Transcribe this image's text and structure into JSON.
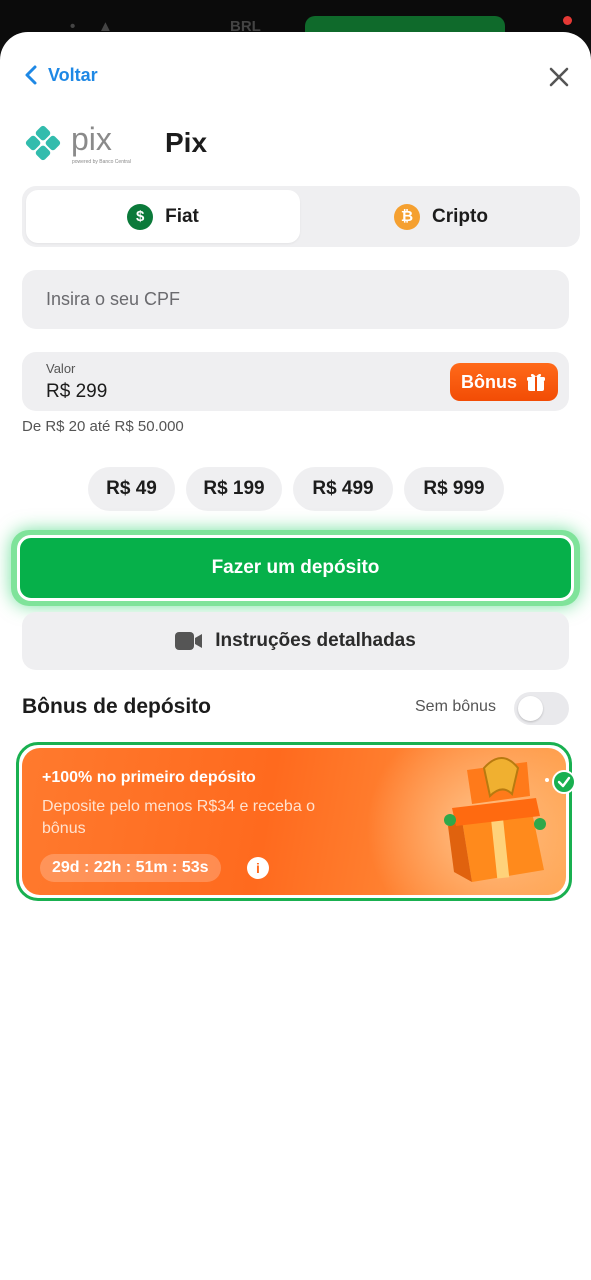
{
  "topbar": {
    "currency": "BRL"
  },
  "header": {
    "back_label": "Voltar"
  },
  "method": {
    "title": "Pix",
    "logo_text": "pix",
    "logo_subtext": "powered by Banco Central"
  },
  "tabs": [
    {
      "label": "Fiat",
      "icon": "dollar-icon",
      "active": true
    },
    {
      "label": "Cripto",
      "icon": "bitcoin-icon",
      "active": false
    }
  ],
  "form": {
    "cpf_placeholder": "Insira o seu CPF",
    "amount_label": "Valor",
    "amount_value": "R$ 299",
    "bonus_button": "Bônus",
    "range_text": "De R$ 20 até R$ 50.000"
  },
  "quick_amounts": [
    "R$ 49",
    "R$ 199",
    "R$ 499",
    "R$ 999"
  ],
  "deposit_button": "Fazer um depósito",
  "instructions_button": "Instruções detalhadas",
  "bonus_section": {
    "title": "Bônus de depósito",
    "toggle_label": "Sem bônus",
    "toggle_on": false
  },
  "bonus_card": {
    "headline": "+100% no primeiro depósito",
    "description": "Deposite pelo menos R$34 e receba o bônus",
    "timer": "29d : 22h : 51m : 53s",
    "info_symbol": "i",
    "selected": true
  },
  "colors": {
    "accent_blue": "#1e88e5",
    "deposit_green": "#06b04a",
    "bonus_orange": "#ff6a1e",
    "pix_teal": "#32bcad"
  }
}
